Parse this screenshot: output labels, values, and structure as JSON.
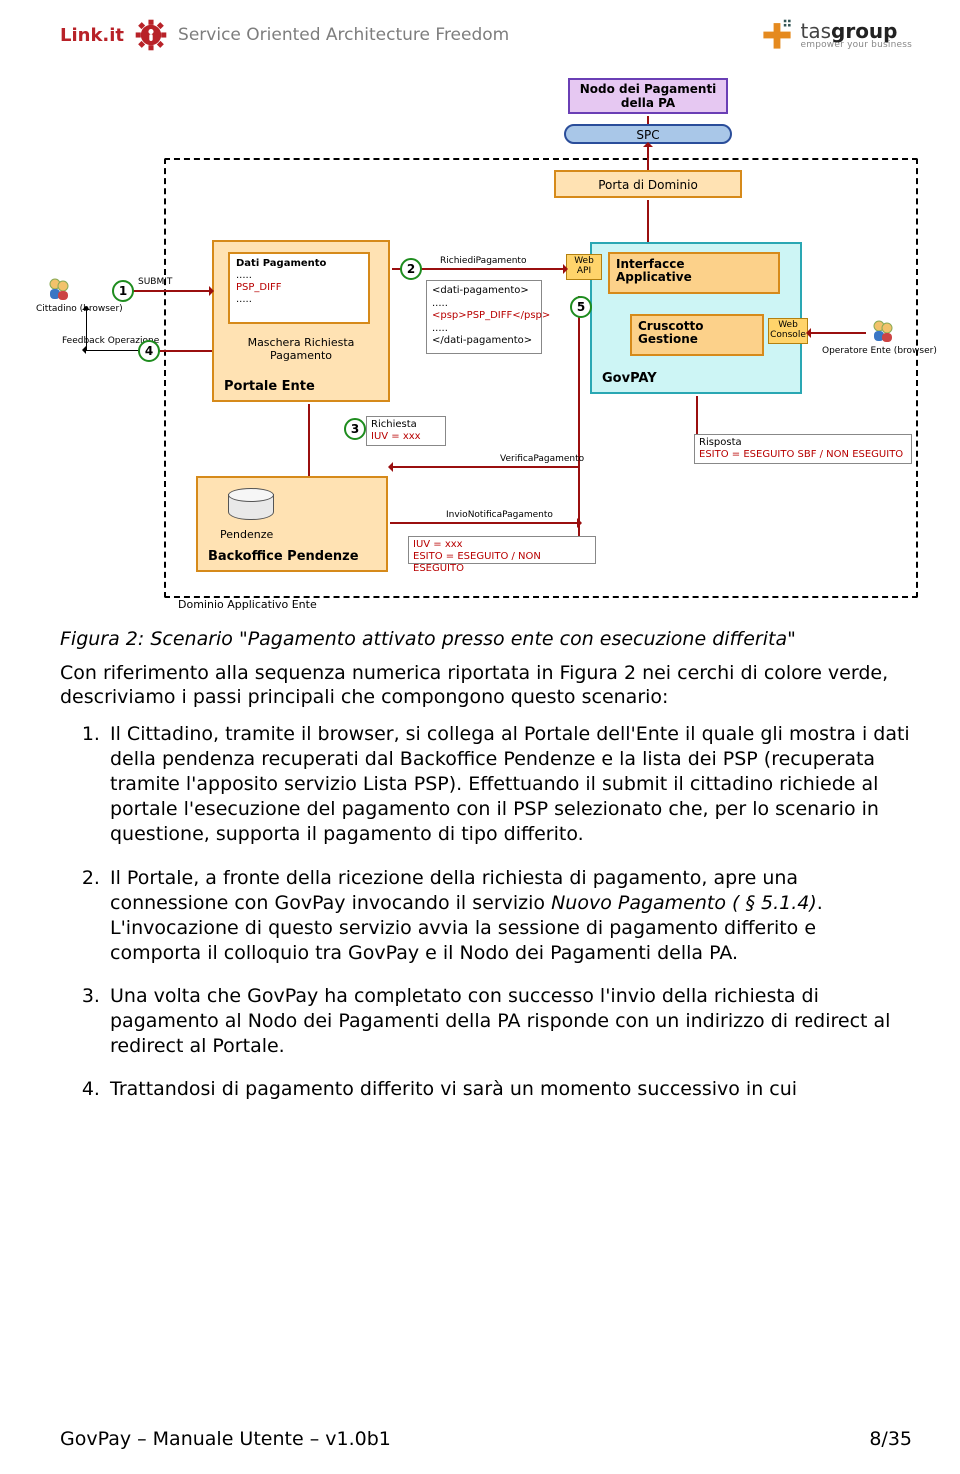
{
  "header": {
    "brand": "Link.it",
    "tagline": "Service Oriented Architecture Freedom",
    "tas_name_light": "tas",
    "tas_name_bold": "group",
    "tas_slogan": "empower your business"
  },
  "diagram": {
    "nodo_pa": "Nodo dei Pagamenti\ndella PA",
    "spc": "SPC",
    "porta_dominio": "Porta di Dominio",
    "interfacce": "Interfacce\nApplicative",
    "web_api": "Web\nAPI",
    "cruscotto": "Cruscotto\nGestione",
    "web_console": "Web\nConsole",
    "govpay": "GovPAY",
    "portale_ente": "Portale Ente",
    "maschera": "Maschera Richiesta\nPagamento",
    "dati_pag": "Dati Pagamento",
    "psp_diff": "PSP_DIFF",
    "xml_dati": "<dati-pagamento>",
    "xml_psp": "<psp>PSP_DIFF</psp>",
    "xml_dati_close": "</dati-pagamento>",
    "pendenze": "Pendenze",
    "backoffice": "Backoffice Pendenze",
    "dominio": "Dominio Applicativo Ente",
    "cittadino": "Cittadino (browser)",
    "operatore": "Operatore Ente (browser)",
    "submit": "SUBMIT",
    "feedback": "Feedback Operazione",
    "richiesta_pag": "RichiediPagamento",
    "verifica": "VerificaPagamento",
    "invio_notifica": "InvioNotificaPagamento",
    "richiesta_iuv": "Richiesta\nIUV = xxx",
    "risposta": "Risposta\nESITO = ESEGUITO SBF / NON ESEGUITO",
    "notifica_esito": "IUV = xxx\nESITO = ESEGUITO / NON ESEGUITO",
    "steps": {
      "1": "1",
      "2": "2",
      "3": "3",
      "4": "4",
      "5": "5"
    }
  },
  "text": {
    "caption": "Figura 2: Scenario \"Pagamento attivato presso ente con esecuzione differita\"",
    "intro": "Con riferimento alla sequenza numerica riportata in Figura 2 nei cerchi di colore verde, descriviamo i passi principali che compongono questo scenario:",
    "li1": "Il Cittadino, tramite il browser, si collega al Portale dell'Ente il quale gli mostra i dati della pendenza recuperati dal Backoffice Pendenze e la lista dei PSP (recuperata tramite l'apposito servizio Lista PSP). Effettuando il submit il cittadino richiede al portale l'esecuzione del pagamento con il PSP selezionato che, per lo scenario in questione, supporta il pagamento di tipo differito.",
    "li2a": "Il Portale, a fronte della ricezione della richiesta di pagamento, apre una connessione con GovPay invocando il servizio ",
    "li2_it": "Nuovo Pagamento ( § 5.1.4)",
    "li2b": ". L'invocazione di questo servizio avvia la sessione di pagamento differito e comporta il colloquio tra GovPay e il Nodo dei Pagamenti della PA.",
    "li3": "Una volta che GovPay ha completato con successo l'invio della richiesta di pagamento al Nodo dei Pagamenti della PA risponde con un indirizzo di redirect al redirect al Portale.",
    "li4": "Trattandosi di pagamento differito vi sarà un momento successivo in cui"
  },
  "footer": {
    "left": "GovPay – Manuale Utente – v1.0b1",
    "right": "8/35"
  },
  "colors": {
    "violet_fill": "#e6c8f2",
    "violet_border": "#6a3fb5",
    "orange_fill": "#ffe2b3",
    "orange_border": "#d68a1a",
    "orange_inner": "#fcd18a",
    "yellow_fill": "#ffd46b",
    "cyan_fill": "#cdf5f5",
    "cyan_border": "#2aa7b3",
    "spc_fill": "#a9c7e8",
    "spc_border": "#2a4d9a",
    "white": "#ffffff"
  }
}
